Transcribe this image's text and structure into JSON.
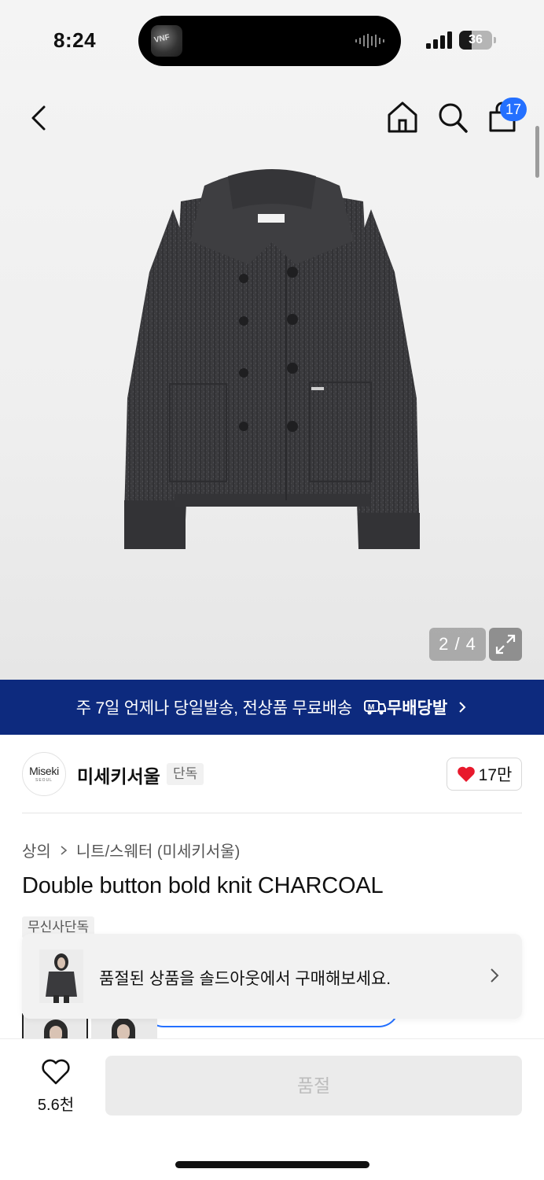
{
  "status_bar": {
    "time": "8:24",
    "battery": "36",
    "island_app_label": "VNF"
  },
  "nav": {
    "cart_count": "17"
  },
  "gallery": {
    "counter": "2 / 4"
  },
  "banner": {
    "text": "주 7일 언제나 당일발송, 전상품 무료배송",
    "logo_text": "무배당발"
  },
  "brand": {
    "logo_text": "Miseki",
    "logo_subtext": "SEOUL",
    "name": "미세키서울",
    "tag": "단독",
    "likes": "17만"
  },
  "breadcrumb": [
    "상의",
    "니트/스웨터 (미세키서울)"
  ],
  "product": {
    "title": "Double button bold knit CHARCOAL",
    "exclusive_tag": "무신사단독"
  },
  "toast": {
    "text": "품절된 상품을 솔드아웃에서 구매해보세요."
  },
  "bottom_bar": {
    "wish_count": "5.6천",
    "buy_label": "품절"
  },
  "colors": {
    "banner_bg": "#0d2a7e",
    "badge_blue": "#2470ff",
    "heart_red": "#e8192c",
    "soldout_bg": "#ebebeb"
  }
}
